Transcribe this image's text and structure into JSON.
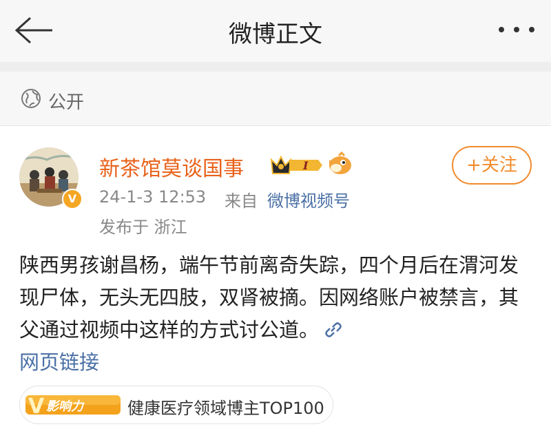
{
  "header": {
    "title": "微博正文"
  },
  "visibility": {
    "label": "公开"
  },
  "author": {
    "name": "新茶馆莫谈国事",
    "level_badge": "I",
    "verified_mark": "V"
  },
  "follow_button": {
    "label": "+关注"
  },
  "meta": {
    "time": "24-1-3 12:53",
    "from_label": "来自",
    "source": "微博视频号",
    "location": "发布于 浙江"
  },
  "post": {
    "text": "陕西男孩谢昌杨，端午节前离奇失踪，四个月后在渭河发现尸体，无头无四肢，双肾被摘。因网络账户被禁言，其父通过视频中这样的方式讨公道。",
    "link_label": "网页链接"
  },
  "influence_tag": {
    "badge_text": "影响力",
    "badge_letter": "V",
    "label": "健康医疗领域博主TOP100"
  },
  "colors": {
    "accent_orange": "#f28b2c",
    "username_orange": "#e8621a",
    "link_blue": "#4a6fa5",
    "header_bg": "#f7f7f7"
  },
  "icons": {
    "back": "back-arrow-icon",
    "more": "more-dots-icon",
    "visibility": "globe-icon",
    "link": "link-icon"
  }
}
